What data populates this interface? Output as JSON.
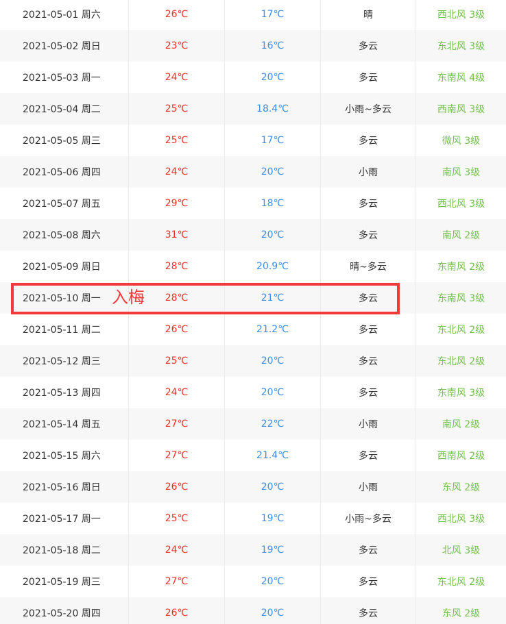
{
  "colors": {
    "high_temp": "#ef2e23",
    "low_temp": "#3d8de6",
    "wind": "#72c14d",
    "highlight": "#f23a3a"
  },
  "annotation": {
    "label": "入梅",
    "highlighted_date": "2021-05-10 周一"
  },
  "rows": [
    {
      "date": "2021-05-01 周六",
      "high": "26℃",
      "low": "17℃",
      "weather": "晴",
      "wind": "西北风 3级"
    },
    {
      "date": "2021-05-02 周日",
      "high": "23℃",
      "low": "16℃",
      "weather": "多云",
      "wind": "东北风 3级"
    },
    {
      "date": "2021-05-03 周一",
      "high": "24℃",
      "low": "20℃",
      "weather": "多云",
      "wind": "东南风 4级"
    },
    {
      "date": "2021-05-04 周二",
      "high": "25℃",
      "low": "18.4℃",
      "weather": "小雨~多云",
      "wind": "西南风 3级"
    },
    {
      "date": "2021-05-05 周三",
      "high": "25℃",
      "low": "17℃",
      "weather": "多云",
      "wind": "微风 3级"
    },
    {
      "date": "2021-05-06 周四",
      "high": "24℃",
      "low": "20℃",
      "weather": "小雨",
      "wind": "南风 3级"
    },
    {
      "date": "2021-05-07 周五",
      "high": "29℃",
      "low": "18℃",
      "weather": "多云",
      "wind": "西北风 3级"
    },
    {
      "date": "2021-05-08 周六",
      "high": "31℃",
      "low": "20℃",
      "weather": "多云",
      "wind": "南风 2级"
    },
    {
      "date": "2021-05-09 周日",
      "high": "28℃",
      "low": "20.9℃",
      "weather": "晴~多云",
      "wind": "东南风 2级"
    },
    {
      "date": "2021-05-10 周一",
      "high": "28℃",
      "low": "21℃",
      "weather": "多云",
      "wind": "东南风 3级"
    },
    {
      "date": "2021-05-11 周二",
      "high": "26℃",
      "low": "21.2℃",
      "weather": "多云",
      "wind": "东北风 2级"
    },
    {
      "date": "2021-05-12 周三",
      "high": "25℃",
      "low": "20℃",
      "weather": "多云",
      "wind": "东北风 2级"
    },
    {
      "date": "2021-05-13 周四",
      "high": "24℃",
      "low": "20℃",
      "weather": "多云",
      "wind": "东南风 3级"
    },
    {
      "date": "2021-05-14 周五",
      "high": "27℃",
      "low": "22℃",
      "weather": "小雨",
      "wind": "南风 2级"
    },
    {
      "date": "2021-05-15 周六",
      "high": "27℃",
      "low": "21.4℃",
      "weather": "多云",
      "wind": "西南风 2级"
    },
    {
      "date": "2021-05-16 周日",
      "high": "26℃",
      "low": "20℃",
      "weather": "小雨",
      "wind": "东风 2级"
    },
    {
      "date": "2021-05-17 周一",
      "high": "25℃",
      "low": "19℃",
      "weather": "小雨~多云",
      "wind": "西北风 3级"
    },
    {
      "date": "2021-05-18 周二",
      "high": "24℃",
      "low": "19℃",
      "weather": "多云",
      "wind": "北风 3级"
    },
    {
      "date": "2021-05-19 周三",
      "high": "27℃",
      "low": "20℃",
      "weather": "多云",
      "wind": "东北风 2级"
    },
    {
      "date": "2021-05-20 周四",
      "high": "26℃",
      "low": "20℃",
      "weather": "多云",
      "wind": "东风 2级"
    }
  ]
}
